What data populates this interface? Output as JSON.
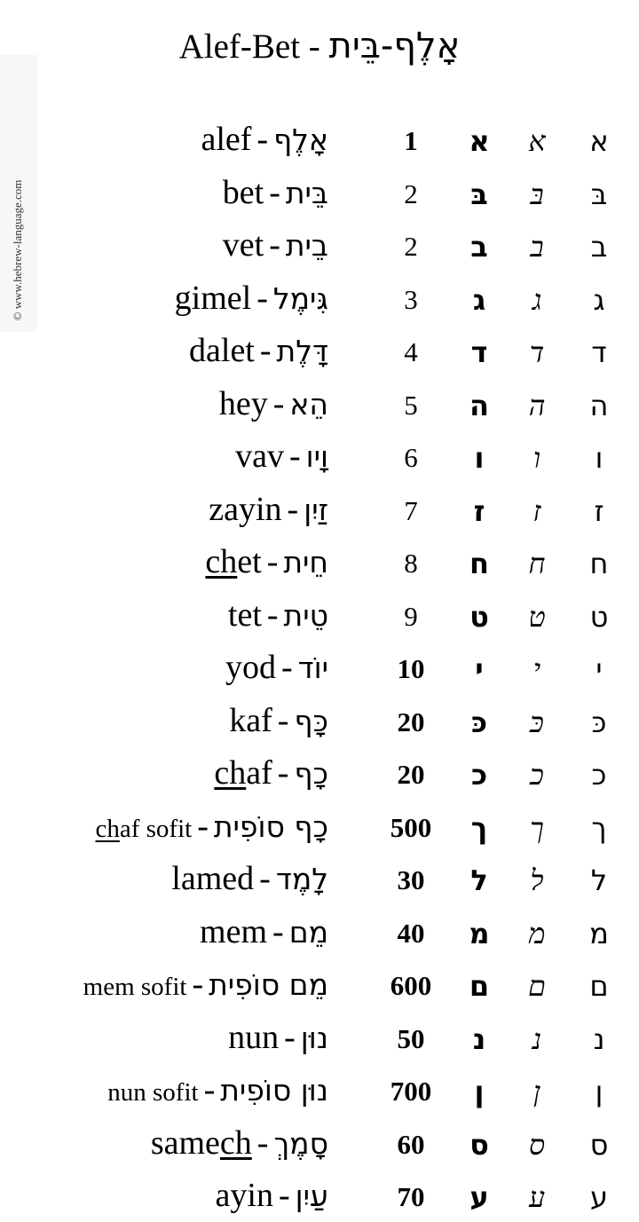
{
  "title": {
    "english": "Alef-Bet",
    "separator": " - ",
    "hebrew": "אָלֶף-בֵּית"
  },
  "watermark": "© www.hebrew-language.com",
  "columns": [
    "name",
    "numeric_value",
    "rashi_script",
    "cursive_script",
    "print_script"
  ],
  "letters": [
    {
      "en": "alef",
      "en_underline": "",
      "en_rest": "alef",
      "he": "אָלֶף",
      "value": "1",
      "bold": true,
      "rashi": "א",
      "cursive": "א",
      "print": "א"
    },
    {
      "en": "bet",
      "en_underline": "",
      "en_rest": "bet",
      "he": "בֵּית",
      "value": "2",
      "bold": false,
      "rashi": "בּ",
      "cursive": "בּ",
      "print": "בּ"
    },
    {
      "en": "vet",
      "en_underline": "",
      "en_rest": "vet",
      "he": "בֵית",
      "value": "2",
      "bold": false,
      "rashi": "ב",
      "cursive": "ב",
      "print": "ב"
    },
    {
      "en": "gimel",
      "en_underline": "",
      "en_rest": "gimel",
      "he": "גִּימֶל",
      "value": "3",
      "bold": false,
      "rashi": "ג",
      "cursive": "ג",
      "print": "ג"
    },
    {
      "en": "dalet",
      "en_underline": "",
      "en_rest": "dalet",
      "he": "דָּלֶת",
      "value": "4",
      "bold": false,
      "rashi": "ד",
      "cursive": "ד",
      "print": "ד"
    },
    {
      "en": "hey",
      "en_underline": "",
      "en_rest": "hey",
      "he": "הֵא",
      "value": "5",
      "bold": false,
      "rashi": "ה",
      "cursive": "ה",
      "print": "ה"
    },
    {
      "en": "vav",
      "en_underline": "",
      "en_rest": "vav",
      "he": "וָיו",
      "value": "6",
      "bold": false,
      "rashi": "ו",
      "cursive": "ו",
      "print": "ו"
    },
    {
      "en": "zayin",
      "en_underline": "",
      "en_rest": "zayin",
      "he": "זַיִן",
      "value": "7",
      "bold": false,
      "rashi": "ז",
      "cursive": "ז",
      "print": "ז"
    },
    {
      "en": "chet",
      "en_underline": "ch",
      "en_rest": "et",
      "he": "חֵית",
      "value": "8",
      "bold": false,
      "rashi": "ח",
      "cursive": "ח",
      "print": "ח"
    },
    {
      "en": "tet",
      "en_underline": "",
      "en_rest": "tet",
      "he": "טֵית",
      "value": "9",
      "bold": false,
      "rashi": "ט",
      "cursive": "ט",
      "print": "ט"
    },
    {
      "en": "yod",
      "en_underline": "",
      "en_rest": "yod",
      "he": "יוֹד",
      "value": "10",
      "bold": true,
      "rashi": "י",
      "cursive": "י",
      "print": "י"
    },
    {
      "en": "kaf",
      "en_underline": "",
      "en_rest": "kaf",
      "he": "כָּף",
      "value": "20",
      "bold": true,
      "rashi": "כּ",
      "cursive": "כּ",
      "print": "כּ"
    },
    {
      "en": "chaf",
      "en_underline": "ch",
      "en_rest": "af",
      "he": "כָף",
      "value": "20",
      "bold": true,
      "rashi": "כ",
      "cursive": "כ",
      "print": "כ"
    },
    {
      "en": "chaf sofit",
      "en_underline": "ch",
      "en_rest": "af sofit",
      "he": "כָף סוֹפִית",
      "value": "500",
      "bold": true,
      "small": true,
      "rashi": "ך",
      "cursive": "ך",
      "print": "ך"
    },
    {
      "en": "lamed",
      "en_underline": "",
      "en_rest": "lamed",
      "he": "לָמֶד",
      "value": "30",
      "bold": true,
      "rashi": "ל",
      "cursive": "ל",
      "print": "ל"
    },
    {
      "en": "mem",
      "en_underline": "",
      "en_rest": "mem",
      "he": "מֵם",
      "value": "40",
      "bold": true,
      "rashi": "מ",
      "cursive": "מ",
      "print": "מ"
    },
    {
      "en": "mem sofit",
      "en_underline": "",
      "en_rest": "mem sofit",
      "he": "מֵם סוֹפִית",
      "value": "600",
      "bold": true,
      "small": true,
      "rashi": "ם",
      "cursive": "ם",
      "print": "ם"
    },
    {
      "en": "nun",
      "en_underline": "",
      "en_rest": "nun",
      "he": "נוּן",
      "value": "50",
      "bold": true,
      "rashi": "נ",
      "cursive": "נ",
      "print": "נ"
    },
    {
      "en": "nun sofit",
      "en_underline": "",
      "en_rest": "nun sofit",
      "he": "נוּן סוֹפִית",
      "value": "700",
      "bold": true,
      "small": true,
      "rashi": "ן",
      "cursive": "ן",
      "print": "ן"
    },
    {
      "en": "samech",
      "en_prefix": "same",
      "en_underline": "ch",
      "en_rest": "",
      "he": "סָמֶךְ",
      "value": "60",
      "bold": true,
      "rashi": "ס",
      "cursive": "ס",
      "print": "ס"
    },
    {
      "en": "ayin",
      "en_underline": "",
      "en_rest": "ayin",
      "he": "עַיִן",
      "value": "70",
      "bold": true,
      "rashi": "ע",
      "cursive": "ע",
      "print": "ע"
    }
  ]
}
